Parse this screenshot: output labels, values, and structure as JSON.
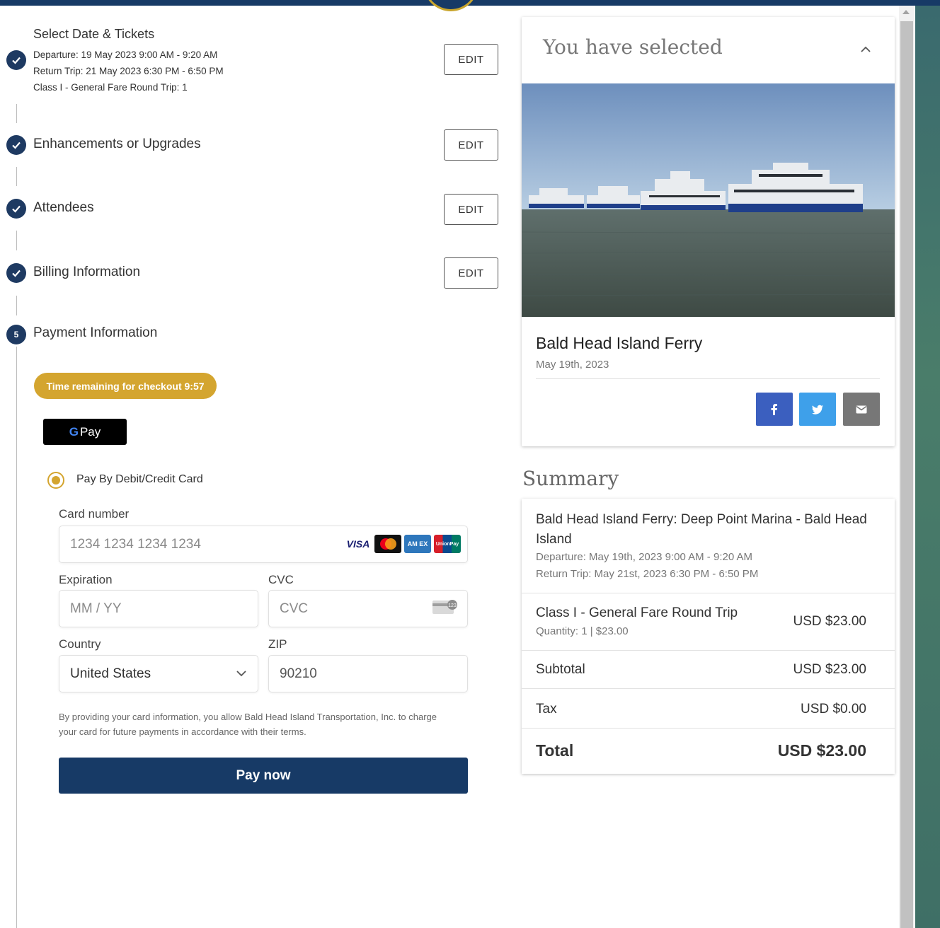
{
  "steps": {
    "step1": {
      "title": "Select Date & Tickets",
      "details": [
        "Departure: 19 May 2023 9:00 AM - 9:20 AM",
        "Return Trip: 21 May 2023 6:30 PM - 6:50 PM",
        "Class I - General Fare Round Trip: 1"
      ],
      "edit_label": "EDIT"
    },
    "step2": {
      "title": "Enhancements or Upgrades",
      "edit_label": "EDIT"
    },
    "step3": {
      "title": "Attendees",
      "edit_label": "EDIT"
    },
    "step4": {
      "title": "Billing Information",
      "edit_label": "EDIT"
    },
    "step5": {
      "number": "5",
      "title": "Payment Information"
    }
  },
  "payment": {
    "timer": "Time remaining for checkout 9:57",
    "gpay_g": "G",
    "gpay_label": "Pay",
    "method_label": "Pay By Debit/Credit Card",
    "card_number_label": "Card number",
    "card_number_placeholder": "1234 1234 1234 1234",
    "brands": {
      "visa": "VISA",
      "amex": "AM EX",
      "unionpay": "UnionPay"
    },
    "expiration_label": "Expiration",
    "expiration_placeholder": "MM / YY",
    "cvc_label": "CVC",
    "cvc_placeholder": "CVC",
    "country_label": "Country",
    "country_value": "United States",
    "zip_label": "ZIP",
    "zip_value": "90210",
    "disclaimer": "By providing your card information, you allow Bald Head Island Transportation, Inc. to charge your card for future payments in accordance with their terms.",
    "pay_button": "Pay now"
  },
  "selected": {
    "heading": "You have selected",
    "event_name": "Bald Head Island Ferry",
    "event_date": "May 19th, 2023",
    "share_icons": [
      "facebook-icon",
      "twitter-icon",
      "email-icon"
    ]
  },
  "summary": {
    "heading": "Summary",
    "trip_title": "Bald Head Island Ferry: Deep Point Marina - Bald Head Island",
    "departure": "Departure: May 19th, 2023 9:00 AM - 9:20 AM",
    "return": "Return Trip: May 21st, 2023 6:30 PM - 6:50 PM",
    "item_name": "Class I - General Fare Round Trip",
    "item_qty": "Quantity: 1 | $23.00",
    "item_price": "USD $23.00",
    "subtotal_label": "Subtotal",
    "subtotal_value": "USD $23.00",
    "tax_label": "Tax",
    "tax_value": "USD $0.00",
    "total_label": "Total",
    "total_value": "USD $23.00"
  },
  "colors": {
    "navy": "#173a66",
    "gold": "#d4a52f",
    "facebook": "#3b5fbf",
    "twitter": "#3ea0ea",
    "email": "#777777"
  }
}
